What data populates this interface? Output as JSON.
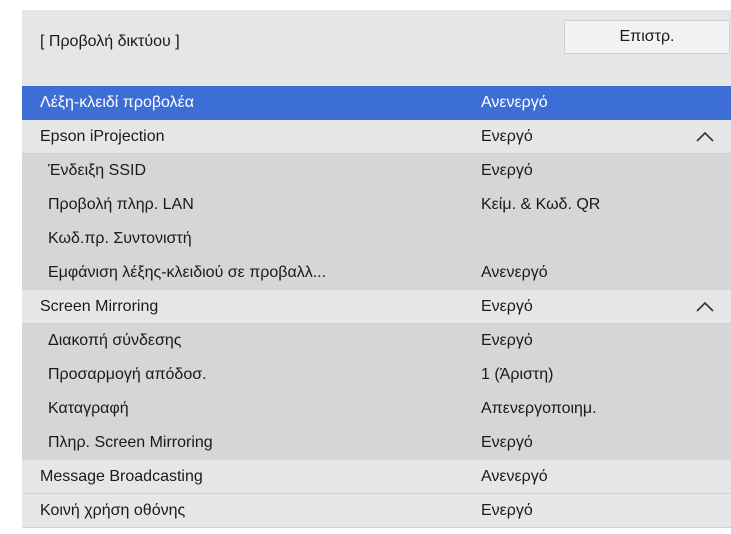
{
  "header": {
    "title": "[ Προβολή δικτύου ]",
    "back_label": "Επιστρ."
  },
  "accent_color": "#3d6ed6",
  "menu_items": [
    {
      "label": "Λέξη-κλειδί προβολέα",
      "value": "Ανενεργό",
      "level": 0,
      "selected": true,
      "expanded": false
    },
    {
      "label": "Epson iProjection",
      "value": "Ενεργό",
      "level": 0,
      "selected": false,
      "expanded": true,
      "icon": "chevron-up-icon"
    },
    {
      "label": "Ένδειξη SSID",
      "value": "Ενεργό",
      "level": 1
    },
    {
      "label": "Προβολή πληρ. LAN",
      "value": "Κείμ. & Κωδ. QR",
      "level": 1
    },
    {
      "label": "Κωδ.πρ. Συντονιστή",
      "value": "",
      "level": 1
    },
    {
      "label": "Εμφάνιση λέξης-κλειδιού σε προβαλλ...",
      "value": "Ανενεργό",
      "level": 1
    },
    {
      "label": "Screen Mirroring",
      "value": "Ενεργό",
      "level": 0,
      "selected": false,
      "expanded": true,
      "icon": "chevron-up-icon"
    },
    {
      "label": "Διακοπή σύνδεσης",
      "value": "Ενεργό",
      "level": 1
    },
    {
      "label": "Προσαρμογή απόδοσ.",
      "value": "1 (Άριστη)",
      "level": 1
    },
    {
      "label": "Καταγραφή",
      "value": "Απενεργοποιημ.",
      "level": 1
    },
    {
      "label": "Πληρ. Screen Mirroring",
      "value": "Ενεργό",
      "level": 1
    },
    {
      "label": "Message Broadcasting",
      "value": "Ανενεργό",
      "level": 0
    },
    {
      "label": "Κοινή χρήση οθόνης",
      "value": "Ενεργό",
      "level": 0
    }
  ]
}
